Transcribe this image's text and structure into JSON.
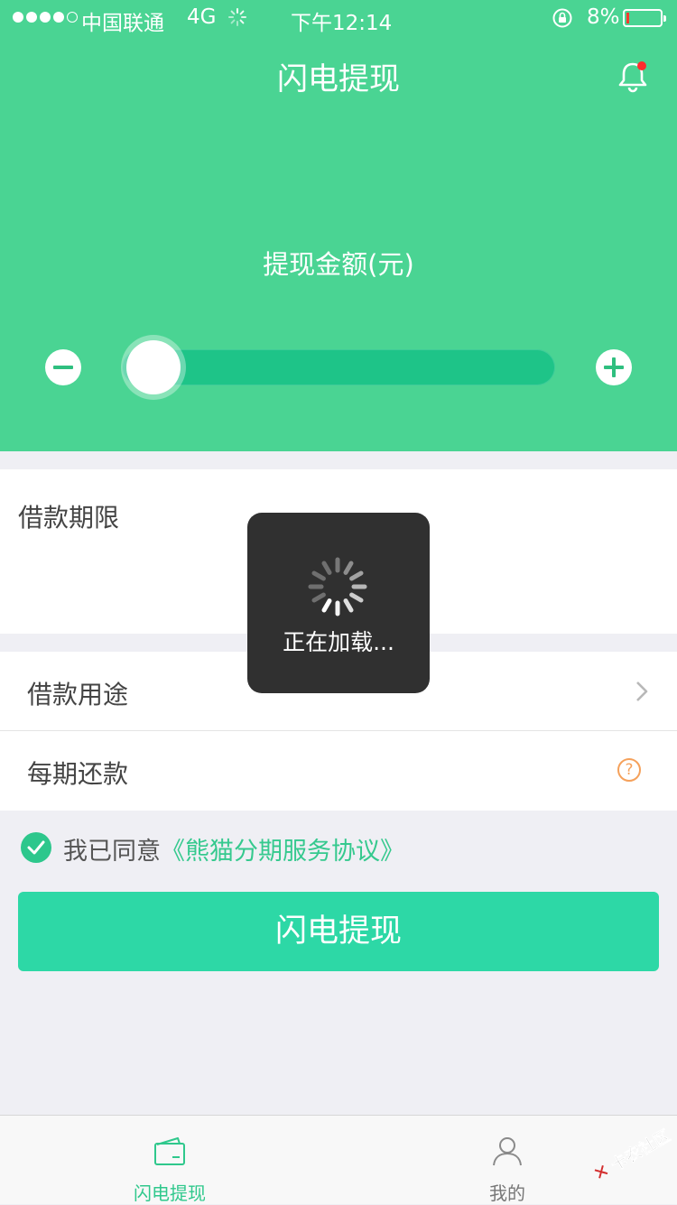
{
  "status_bar": {
    "carrier": "中国联通",
    "network": "4G",
    "time": "下午12:14",
    "battery_percent": "8%",
    "battery_level": 0.08
  },
  "header": {
    "title": "闪电提现",
    "amount_label": "提现金额(元)",
    "slider_value": 0.0
  },
  "form": {
    "loan_term_label": "借款期限",
    "loan_purpose_label": "借款用途",
    "installment_label": "每期还款",
    "help_symbol": "?"
  },
  "agreement": {
    "text": "我已同意",
    "link": "《熊猫分期服务协议》"
  },
  "primary_button": "闪电提现",
  "tab_bar": {
    "items": [
      {
        "label": "闪电提现",
        "icon": "wallet-icon",
        "active": true
      },
      {
        "label": "我的",
        "icon": "user-icon",
        "active": false
      }
    ]
  },
  "loading_toast": {
    "text": "正在加载..."
  },
  "watermark": "卡农社区",
  "colors": {
    "brand_green": "#4ad493",
    "button_green": "#2dd8a6",
    "link_green": "#35c98e",
    "help_orange": "#f5a15b",
    "notification_red": "#ff2d2d"
  }
}
